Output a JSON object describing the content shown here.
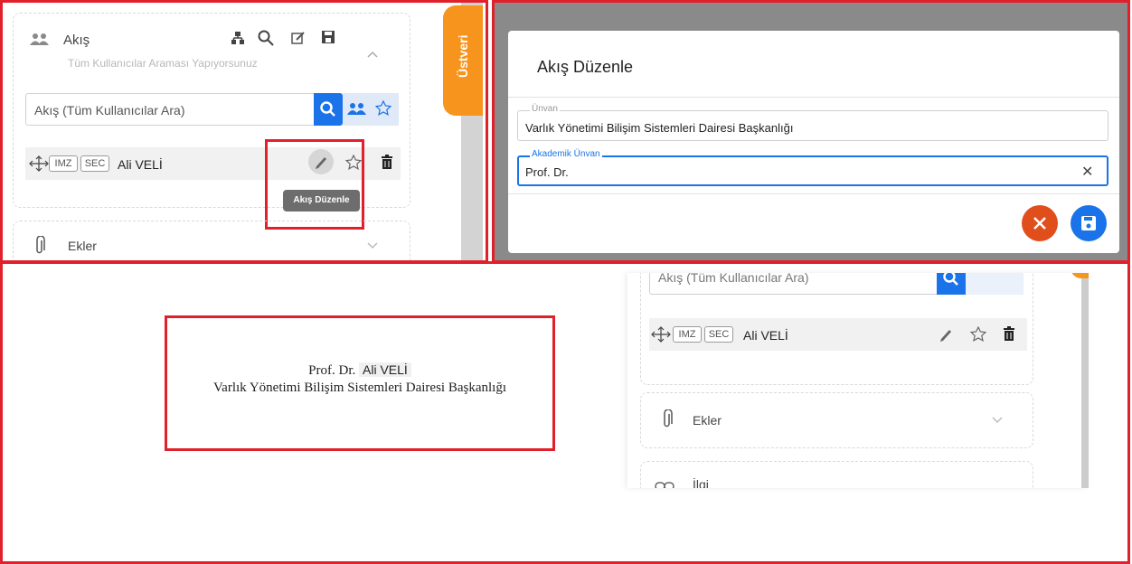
{
  "panel1": {
    "title": "Akış",
    "subtitle": "Tüm Kullanıcılar Araması Yapıyorsunuz",
    "search_placeholder": "Akış (Tüm Kullanıcılar Ara)",
    "row": {
      "badge1": "IMZ",
      "badge2": "SEC",
      "name": "Ali VELİ"
    },
    "tooltip": "Akış Düzenle",
    "attachments_label": "Ekler",
    "side_tab": "Üstveri"
  },
  "panel2": {
    "dialog_title": "Akış Düzenle",
    "field1": {
      "legend": "Ünvan",
      "value": "Varlık Yönetimi Bilişim Sistemleri Dairesi Başkanlığı"
    },
    "field2": {
      "legend": "Akademik Ünvan",
      "value": "Prof. Dr."
    },
    "clear_symbol": "✕"
  },
  "panel3": {
    "doc_prefix": "Prof. Dr.",
    "doc_name": "Ali VELİ",
    "doc_line2": "Varlık Yönetimi Bilişim Sistemleri Dairesi Başkanlığı",
    "search_placeholder": "Akış (Tüm Kullanıcılar Ara)",
    "row": {
      "badge1": "IMZ",
      "badge2": "SEC",
      "name": "Ali VELİ"
    },
    "attachments_label": "Ekler",
    "related_label": "İlgi"
  },
  "colors": {
    "accent": "#1a73e8",
    "highlight": "#e0202a",
    "orange": "#f7941d",
    "danger": "#e04e1b",
    "save": "#1a73e8"
  }
}
